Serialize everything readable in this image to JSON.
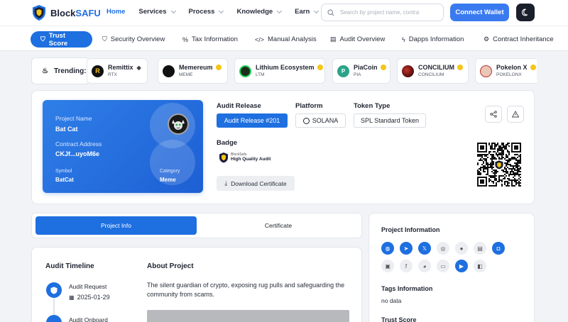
{
  "header": {
    "brand_prefix": "Block",
    "brand_suffix": "SAFU",
    "nav": [
      "Home",
      "Services",
      "Process",
      "Knowledge",
      "Earn"
    ],
    "search_placeholder": "Search by project name, contra",
    "connect_label": "Connect Wallet"
  },
  "tabs": [
    "Trust Score",
    "Security Overview",
    "Tax Information",
    "Manual Analysis",
    "Audit Overview",
    "Dapps Information",
    "Contract Inheritance"
  ],
  "trending": {
    "label": "Trending:",
    "items": [
      {
        "name": "Remittix",
        "symbol": "RTX"
      },
      {
        "name": "Memereum",
        "symbol": "MEME"
      },
      {
        "name": "Lithium Ecosystem",
        "symbol": "LTM"
      },
      {
        "name": "PiaCoin",
        "symbol": "PIA"
      },
      {
        "name": "CONCILIUM",
        "symbol": "CONCILIUM"
      },
      {
        "name": "Pokelon X",
        "symbol": "POKELONX"
      }
    ]
  },
  "project_card": {
    "name_label": "Project Name",
    "name": "Bat Cat",
    "contract_label": "Contract Address",
    "contract": "CKJf...uyoM6e",
    "symbol_label": "Symbol",
    "symbol": "BatCat",
    "category_label": "Category",
    "category": "Meme"
  },
  "audit": {
    "release_title": "Audit Release",
    "release_value": "Audit Release #201",
    "platform_title": "Platform",
    "platform_value": "SOLANA",
    "token_type_title": "Token Type",
    "token_type_value": "SPL Standard Token",
    "badge_title": "Badge",
    "badge_line1": "BlockSafu",
    "badge_line2": "High Quality Audit",
    "download_label": "Download Certificate"
  },
  "lower_tabs": {
    "project_info": "Project Info",
    "certificate": "Certificate"
  },
  "timeline": {
    "title": "Audit Timeline",
    "steps": [
      {
        "label": "Audit Request",
        "date": "2025-01-29"
      },
      {
        "label": "Audit Onboard"
      }
    ]
  },
  "about": {
    "title": "About Project",
    "text": "The silent guardian of crypto, exposing rug pulls and safeguarding the community from scams."
  },
  "side": {
    "project_info_title": "Project Information",
    "social_icons": [
      "globe-icon",
      "telegram-icon",
      "x-icon",
      "discord-icon",
      "github-icon",
      "document-icon",
      "instagram-icon",
      "medium-icon",
      "facebook-icon",
      "reddit-icon",
      "youtube-icon",
      "video-icon",
      "twitch-icon"
    ],
    "tags_title": "Tags Information",
    "tags_value": "no data",
    "trust_title": "Trust Score"
  },
  "colors": {
    "accent": "#1e6fe0",
    "brand_dark": "#1a1f36",
    "badge_gold": "#f5c518"
  }
}
